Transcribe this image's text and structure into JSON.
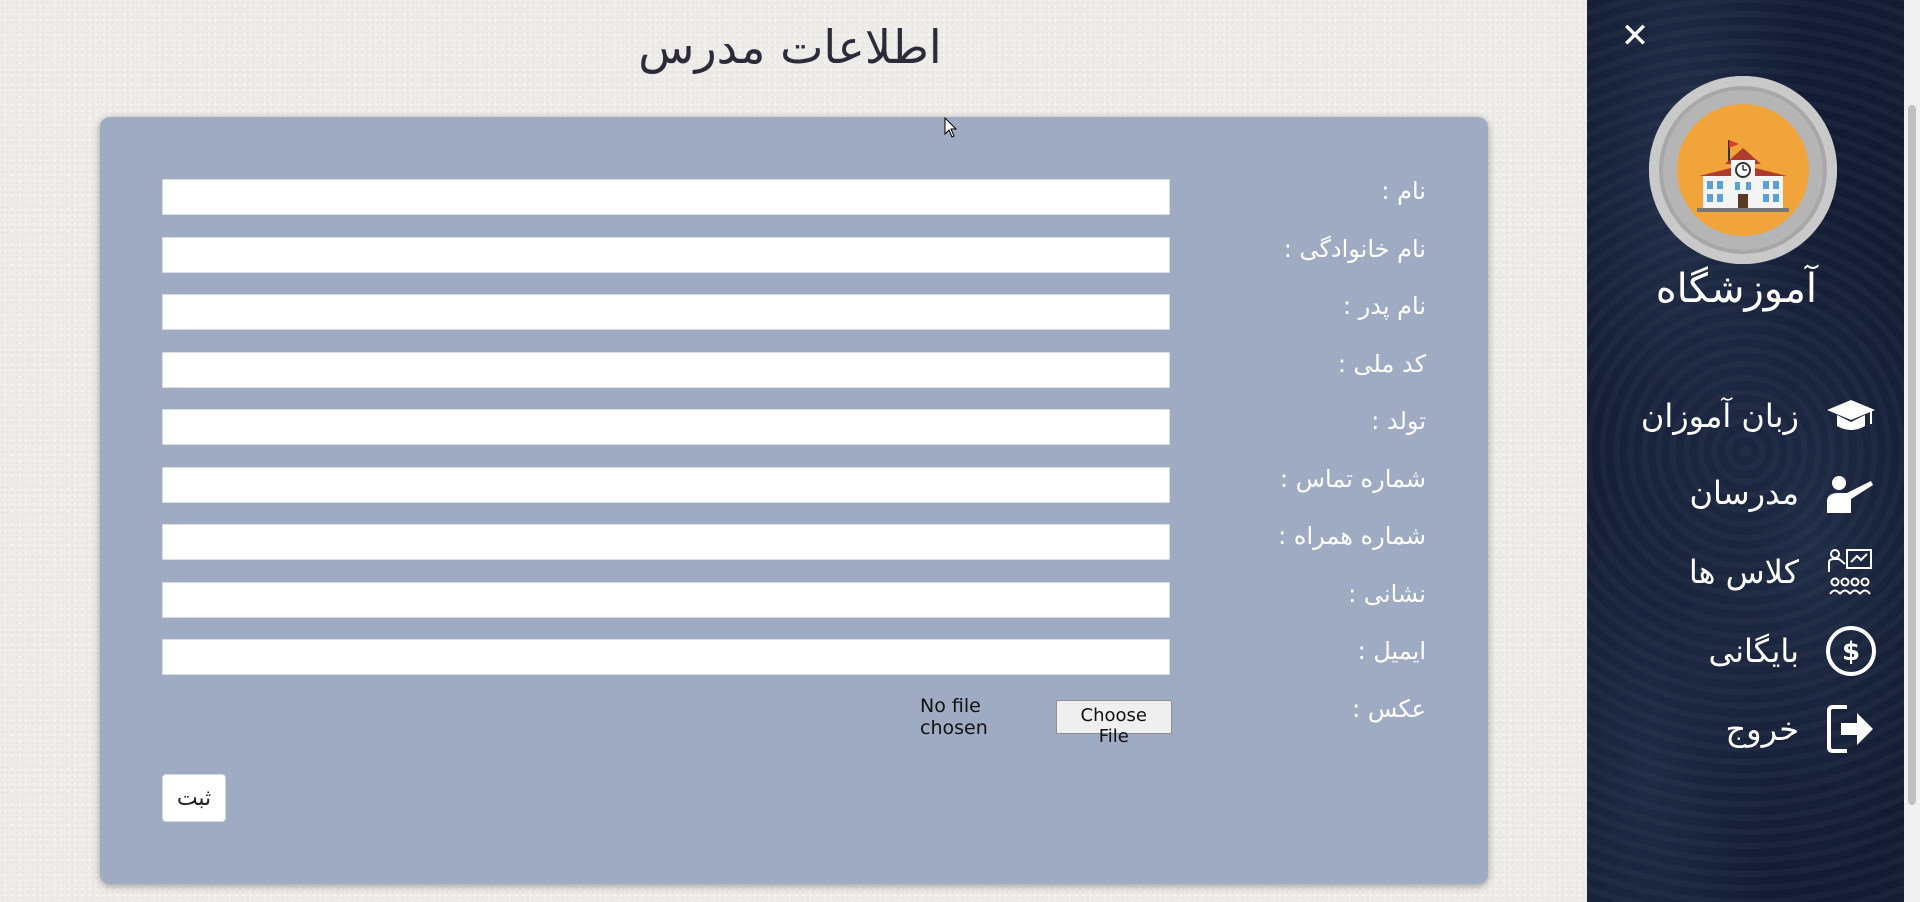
{
  "page": {
    "title": "اطلاعات مدرس"
  },
  "form": {
    "fields": [
      {
        "label": "نام :",
        "value": ""
      },
      {
        "label": "نام خانوادگی :",
        "value": ""
      },
      {
        "label": "نام پدر :",
        "value": ""
      },
      {
        "label": "کد ملی :",
        "value": ""
      },
      {
        "label": "تولد :",
        "value": ""
      },
      {
        "label": "شماره تماس :",
        "value": ""
      },
      {
        "label": "شماره همراه :",
        "value": ""
      },
      {
        "label": "نشانی :",
        "value": ""
      },
      {
        "label": "ایمیل :",
        "value": ""
      }
    ],
    "photo_label": "عکس :",
    "choose_file_label": "Choose File",
    "no_file_text": "No file chosen",
    "submit_label": "ثبت"
  },
  "sidebar": {
    "close_symbol": "✕",
    "brand_name": "آموزشگاه",
    "items": [
      {
        "label": "زبان آموزان",
        "icon": "graduation-cap-icon"
      },
      {
        "label": "مدرسان",
        "icon": "teacher-icon"
      },
      {
        "label": "کلاس ها",
        "icon": "classroom-icon"
      },
      {
        "label": "بایگانی",
        "icon": "dollar-circle-icon"
      },
      {
        "label": "خروج",
        "icon": "sign-out-icon"
      }
    ]
  },
  "colors": {
    "form_card": "#9eabc2",
    "sidebar": "#131c33",
    "logo_accent": "#f0a43a"
  }
}
